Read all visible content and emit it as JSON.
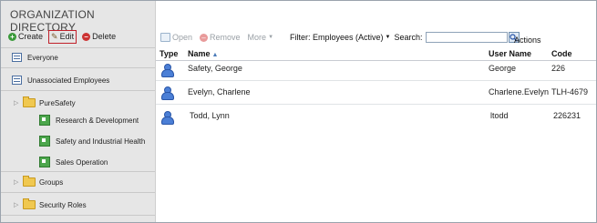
{
  "sidebar": {
    "title": "ORGANIZATION DIRECTORY",
    "toolbar": {
      "create": "Create",
      "edit": "Edit",
      "delete": "Delete"
    },
    "items": [
      {
        "label": "Everyone",
        "icon": "list-icon"
      },
      {
        "label": "Unassociated Employees",
        "icon": "list-icon"
      },
      {
        "label": "PureSafety",
        "icon": "folder-icon"
      },
      {
        "label": "Research & Development",
        "icon": "org-unit-icon"
      },
      {
        "label": "Safety and Industrial Health",
        "icon": "org-unit-icon"
      },
      {
        "label": "Sales Operation",
        "icon": "org-unit-icon"
      },
      {
        "label": "Groups",
        "icon": "folder-icon"
      },
      {
        "label": "Security Roles",
        "icon": "folder-icon"
      }
    ]
  },
  "main": {
    "toolbar": {
      "open": "Open",
      "remove": "Remove",
      "more": "More",
      "filter": "Filter: Employees (Active)",
      "search_label": "Search:",
      "search_value": ""
    },
    "actions_label": "Actions",
    "columns": {
      "type": "Type",
      "name": "Name",
      "username": "User Name",
      "code": "Code"
    },
    "rows": [
      {
        "name": "Safety, George",
        "username": "George",
        "code": "226"
      },
      {
        "name": "Evelyn, Charlene",
        "username": "Charlene.Evelyn",
        "code": "TLH-4679"
      },
      {
        "name": "Todd, Lynn",
        "username": "ltodd",
        "code": "226231"
      }
    ]
  },
  "colors": {
    "sidebar_bg": "#e6e6e6",
    "edit_outline": "#c0202a",
    "user_icon": "#4b7fd6",
    "org_unit_icon": "#4ca64c"
  }
}
